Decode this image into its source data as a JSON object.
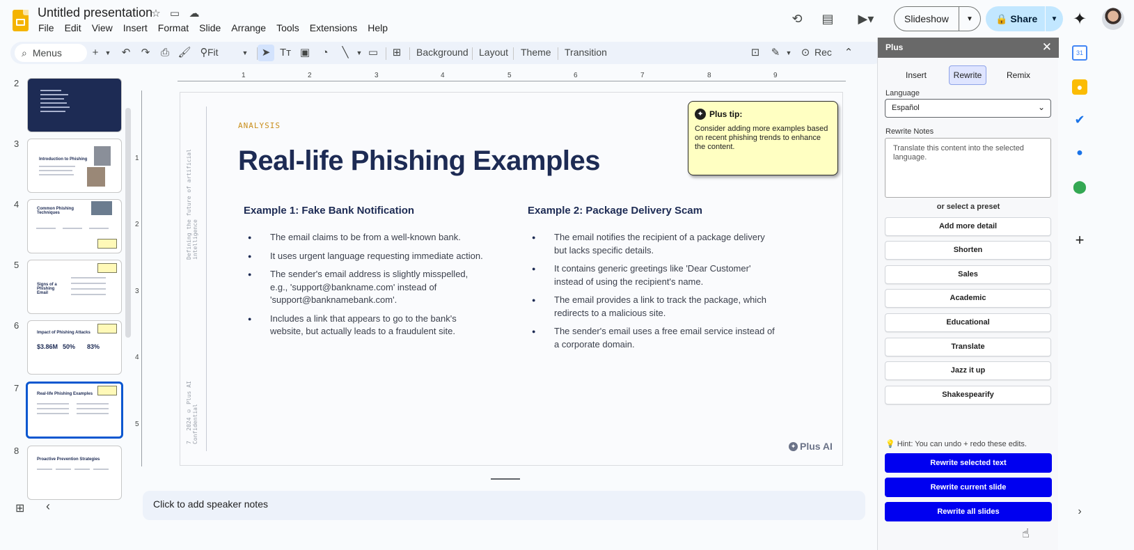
{
  "header": {
    "title": "Untitled presentation",
    "menu": [
      "File",
      "Edit",
      "View",
      "Insert",
      "Format",
      "Slide",
      "Arrange",
      "Tools",
      "Extensions",
      "Help"
    ],
    "slideshow_label": "Slideshow",
    "share_label": "Share"
  },
  "toolbar": {
    "search_label": "Menus",
    "zoom": "Fit",
    "background_label": "Background",
    "layout_label": "Layout",
    "theme_label": "Theme",
    "transition_label": "Transition",
    "rec_label": "Rec"
  },
  "filmstrip": {
    "slide_numbers": [
      "2",
      "3",
      "4",
      "5",
      "6",
      "7",
      "8"
    ],
    "selected": "7",
    "thumb3_title": "Introduction to Phishing",
    "thumb4_title": "Common Phishing Techniques",
    "thumb5_title": "Signs of a Phishing Email",
    "thumb6_title": "Impact of Phishing Attacks",
    "thumb6_stats": [
      "$3.86M",
      "50%",
      "83%"
    ],
    "thumb7_title": "Real-life Phishing Examples",
    "thumb8_title": "Proactive Prevention Strategies"
  },
  "ruler": {
    "h_numbers": [
      "1",
      "2",
      "3",
      "4",
      "5",
      "6",
      "7",
      "8",
      "9"
    ],
    "v_numbers": [
      "1",
      "2",
      "3",
      "4",
      "5"
    ]
  },
  "slide": {
    "vertical_text_top": "Defining the future of artificial intelligence",
    "vertical_text_bottom": "2024 © Plus AI Confidential",
    "page_number": "7",
    "kicker": "ANALYSIS",
    "title": "Real-life Phishing Examples",
    "example1": {
      "heading": "Example 1: Fake Bank Notification",
      "bullets": [
        "The email claims to be from a well-known bank.",
        "It uses urgent language requesting immediate action.",
        "The sender's email address is slightly misspelled, e.g., 'support@bankname.com' instead of 'support@banknamebank.com'.",
        "Includes a link that appears to go to the bank's website, but actually leads to a fraudulent site."
      ]
    },
    "example2": {
      "heading": "Example 2: Package Delivery Scam",
      "bullets": [
        "The email notifies the recipient of a package delivery but lacks specific details.",
        "It contains generic greetings like 'Dear Customer' instead of using the recipient's name.",
        "The email provides a link to track the package, which redirects to a malicious site.",
        "The sender's email uses a free email service instead of a corporate domain."
      ]
    },
    "tip_title": "Plus tip:",
    "tip_body": "Consider adding more examples based on recent phishing trends to enhance the content.",
    "logo_text": "Plus AI"
  },
  "speaker_notes_placeholder": "Click to add speaker notes",
  "panel": {
    "title": "Plus",
    "tabs": [
      "Insert",
      "Rewrite",
      "Remix"
    ],
    "active_tab": "Rewrite",
    "language_label": "Language",
    "language_value": "Español",
    "notes_label": "Rewrite Notes",
    "notes_value": "Translate this content into the selected language.",
    "preset_label": "or select a preset",
    "presets": [
      "Add more detail",
      "Shorten",
      "Sales",
      "Academic",
      "Educational",
      "Translate",
      "Jazz it up",
      "Shakespearify"
    ],
    "hint": "Hint: You can undo + redo these edits.",
    "actions": [
      "Rewrite selected text",
      "Rewrite current slide",
      "Rewrite all slides"
    ]
  },
  "colors": {
    "accent_blue": "#0000f0",
    "slide_navy": "#1d2b54",
    "kicker_gold": "#c98e1a",
    "tip_yellow": "#ffffc2"
  }
}
